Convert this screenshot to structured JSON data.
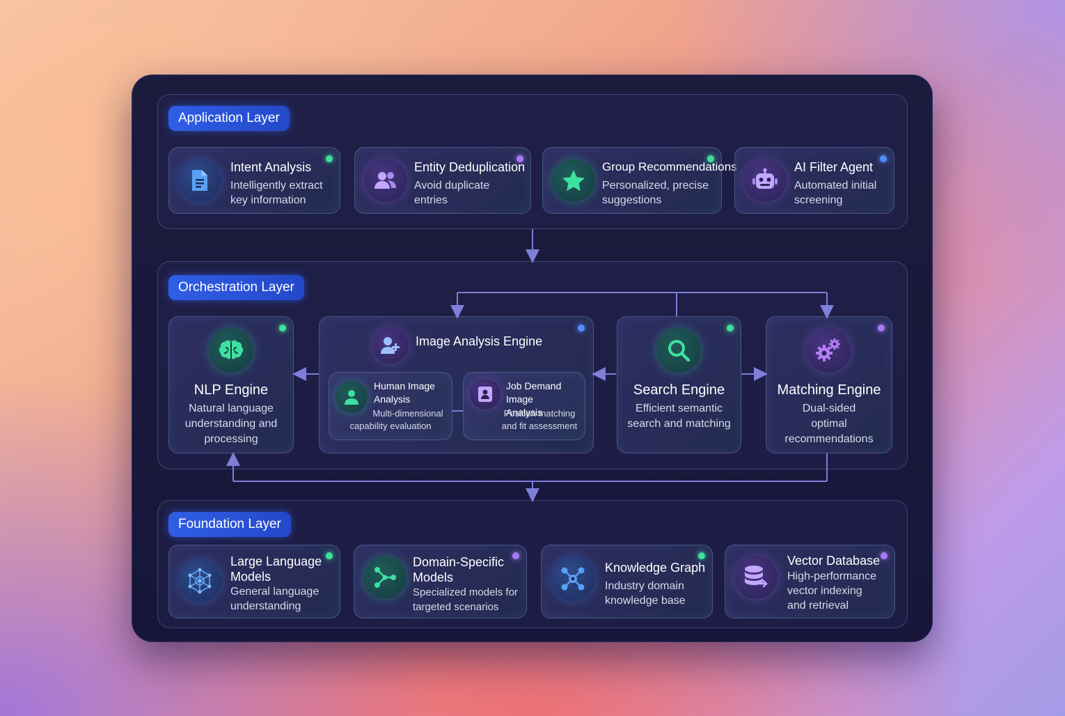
{
  "layers": {
    "application": {
      "label": "Application Layer",
      "cards": [
        {
          "title": "Intent Analysis",
          "desc": [
            "Intelligently extract",
            "key information"
          ],
          "icon": "document-icon",
          "dot": "green"
        },
        {
          "title": "Entity Deduplication",
          "desc": [
            "Avoid duplicate",
            "entries"
          ],
          "icon": "users-icon",
          "dot": "purple"
        },
        {
          "title": "Group Recommendations",
          "desc": [
            "Personalized, precise",
            "suggestions"
          ],
          "icon": "star-icon",
          "dot": "green"
        },
        {
          "title": "AI Filter Agent",
          "desc": [
            "Automated initial",
            "screening"
          ],
          "icon": "robot-icon",
          "dot": "blue"
        }
      ]
    },
    "orchestration": {
      "label": "Orchestration Layer",
      "nlp": {
        "title": "NLP Engine",
        "desc": [
          "Natural language",
          "understanding and",
          "processing"
        ],
        "icon": "brain-icon"
      },
      "image": {
        "title": "Image Analysis Engine",
        "icon": "user-plus-icon",
        "human": {
          "title": [
            "Human Image",
            "Analysis"
          ],
          "desc": [
            "Multi-dimensional",
            "capability evaluation"
          ],
          "icon": "person-icon"
        },
        "job": {
          "title": [
            "Job Demand Image",
            "Analysis"
          ],
          "desc": [
            "Position matching",
            "and fit assessment"
          ],
          "icon": "id-card-icon"
        }
      },
      "search": {
        "title": "Search Engine",
        "desc": [
          "Efficient semantic",
          "search and matching"
        ],
        "icon": "search-icon"
      },
      "matching": {
        "title": "Matching Engine",
        "desc": [
          "Dual-sided",
          "optimal",
          "recommendations"
        ],
        "icon": "gears-icon"
      }
    },
    "foundation": {
      "label": "Foundation Layer",
      "cards": [
        {
          "title": [
            "Large Language",
            "Models"
          ],
          "desc": [
            "General language",
            "understanding"
          ],
          "icon": "neural-network-icon",
          "dot": "green"
        },
        {
          "title": [
            "Domain-Specific",
            "Models"
          ],
          "desc": [
            "Specialized models for",
            "targeted scenarios"
          ],
          "icon": "branch-icon",
          "dot": "purple"
        },
        {
          "title": [
            "Knowledge Graph"
          ],
          "desc": [
            "Industry domain",
            "knowledge base"
          ],
          "icon": "graph-icon",
          "dot": "green"
        },
        {
          "title": [
            "Vector Database"
          ],
          "desc": [
            "High-performance",
            "vector indexing",
            "and retrieval"
          ],
          "icon": "database-icon",
          "dot": "purple"
        }
      ]
    }
  },
  "colors": {
    "accent_blue": "#2f5ee6",
    "dot_green": "#3ee09a",
    "dot_purple": "#a879f5",
    "dot_blue": "#4f8df7",
    "connector": "#7d7fd8"
  }
}
